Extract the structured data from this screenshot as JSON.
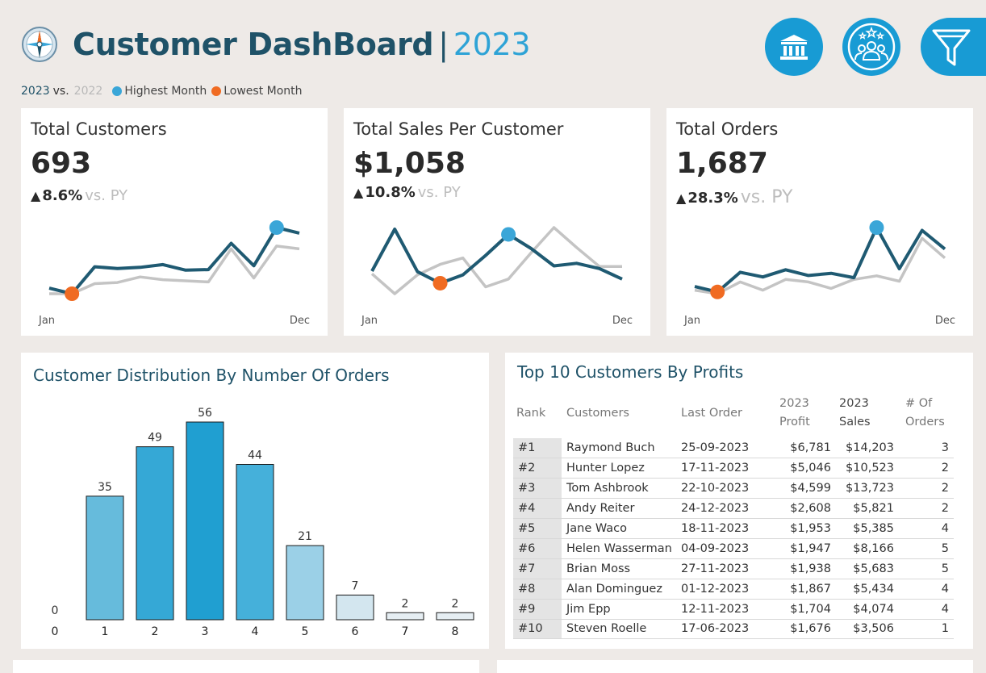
{
  "header": {
    "title": "Customer DashBoard",
    "separator": "|",
    "year": "2023",
    "logo_icon": "compass-icon",
    "nav": [
      {
        "name": "bank-icon"
      },
      {
        "name": "customers-icon"
      },
      {
        "name": "filter-icon"
      }
    ]
  },
  "legend": {
    "current": "2023",
    "vs": "vs.",
    "previous": "2022",
    "highest_label": "Highest Month",
    "lowest_label": "Lowest Month"
  },
  "colors": {
    "current_line": "#1f5a72",
    "previous_line": "#c4c4c4",
    "highest": "#3aa6d8",
    "lowest": "#f06b22",
    "accent": "#189bd4"
  },
  "kpis": [
    {
      "title": "Total Customers",
      "value": "693",
      "change": "8.6%",
      "vs_label": "vs. PY",
      "month_start": "Jan",
      "month_end": "Dec",
      "series_current": [
        0.2,
        0.1,
        0.58,
        0.55,
        0.57,
        0.62,
        0.52,
        0.53,
        1.0,
        0.6,
        1.28,
        1.18
      ],
      "series_previous": [
        0.1,
        0.1,
        0.28,
        0.3,
        0.4,
        0.35,
        0.33,
        0.31,
        0.9,
        0.38,
        0.95,
        0.9
      ],
      "max_index": 10,
      "min_index": 1
    },
    {
      "title": "Total Sales Per Customer",
      "value": "$1,058",
      "change": "10.8%",
      "vs_label": "vs. PY",
      "month_start": "Jan",
      "month_end": "Dec",
      "series_current": [
        0.75,
        1.55,
        0.74,
        0.52,
        0.68,
        1.05,
        1.45,
        1.18,
        0.85,
        0.9,
        0.8,
        0.6
      ],
      "series_previous": [
        0.7,
        0.32,
        0.68,
        0.88,
        1.0,
        0.45,
        0.6,
        1.1,
        1.58,
        1.2,
        0.84,
        0.84
      ],
      "max_index": 6,
      "min_index": 3
    },
    {
      "title": "Total Orders",
      "value": "1,687",
      "change": "28.3%",
      "vs_label": "vs. PY",
      "month_start": "Jan",
      "month_end": "Dec",
      "series_current": [
        0.35,
        0.2,
        0.75,
        0.62,
        0.82,
        0.66,
        0.72,
        0.6,
        2.0,
        0.85,
        1.92,
        1.4
      ],
      "series_previous": [
        0.25,
        0.15,
        0.48,
        0.25,
        0.55,
        0.48,
        0.3,
        0.55,
        0.65,
        0.5,
        1.7,
        1.15
      ],
      "max_index": 8,
      "min_index": 1
    }
  ],
  "distribution": {
    "title": "Customer Distribution By Number Of Orders",
    "chart_data": {
      "type": "bar",
      "categories": [
        "0",
        "1",
        "2",
        "3",
        "4",
        "5",
        "6",
        "7",
        "8"
      ],
      "values": [
        0,
        35,
        49,
        56,
        44,
        21,
        7,
        2,
        2
      ],
      "colors": [
        "#66bbdc",
        "#66bbdc",
        "#35a8d6",
        "#209fd1",
        "#45b0da",
        "#9bd0e7",
        "#d3e6ef",
        "#e6eef3",
        "#e6eef3"
      ],
      "ylim": [
        0,
        56
      ],
      "xlabel": "",
      "ylabel": ""
    }
  },
  "top10": {
    "title": "Top 10 Customers By Profits",
    "columns": {
      "rank": "Rank",
      "customers": "Customers",
      "last_order": "Last Order",
      "profit_line1": "2023",
      "profit_line2": "Profit",
      "sales_line1": "2023",
      "sales_line2": "Sales",
      "orders_line1": "# Of",
      "orders_line2": "Orders"
    },
    "rows": [
      {
        "rank": "#1",
        "customer": "Raymond Buch",
        "last_order": "25-09-2023",
        "profit": "$6,781",
        "sales": "$14,203",
        "orders": "3"
      },
      {
        "rank": "#2",
        "customer": "Hunter Lopez",
        "last_order": "17-11-2023",
        "profit": "$5,046",
        "sales": "$10,523",
        "orders": "2"
      },
      {
        "rank": "#3",
        "customer": "Tom Ashbrook",
        "last_order": "22-10-2023",
        "profit": "$4,599",
        "sales": "$13,723",
        "orders": "2"
      },
      {
        "rank": "#4",
        "customer": "Andy Reiter",
        "last_order": "24-12-2023",
        "profit": "$2,608",
        "sales": "$5,821",
        "orders": "2"
      },
      {
        "rank": "#5",
        "customer": "Jane Waco",
        "last_order": "18-11-2023",
        "profit": "$1,953",
        "sales": "$5,385",
        "orders": "4"
      },
      {
        "rank": "#6",
        "customer": "Helen Wasserman",
        "last_order": "04-09-2023",
        "profit": "$1,947",
        "sales": "$8,166",
        "orders": "5"
      },
      {
        "rank": "#7",
        "customer": "Brian Moss",
        "last_order": "27-11-2023",
        "profit": "$1,938",
        "sales": "$5,683",
        "orders": "5"
      },
      {
        "rank": "#8",
        "customer": "Alan Dominguez",
        "last_order": "01-12-2023",
        "profit": "$1,867",
        "sales": "$5,434",
        "orders": "4"
      },
      {
        "rank": "#9",
        "customer": "Jim Epp",
        "last_order": "12-11-2023",
        "profit": "$1,704",
        "sales": "$4,074",
        "orders": "4"
      },
      {
        "rank": "#10",
        "customer": "Steven Roelle",
        "last_order": "17-06-2023",
        "profit": "$1,676",
        "sales": "$3,506",
        "orders": "1"
      }
    ]
  }
}
